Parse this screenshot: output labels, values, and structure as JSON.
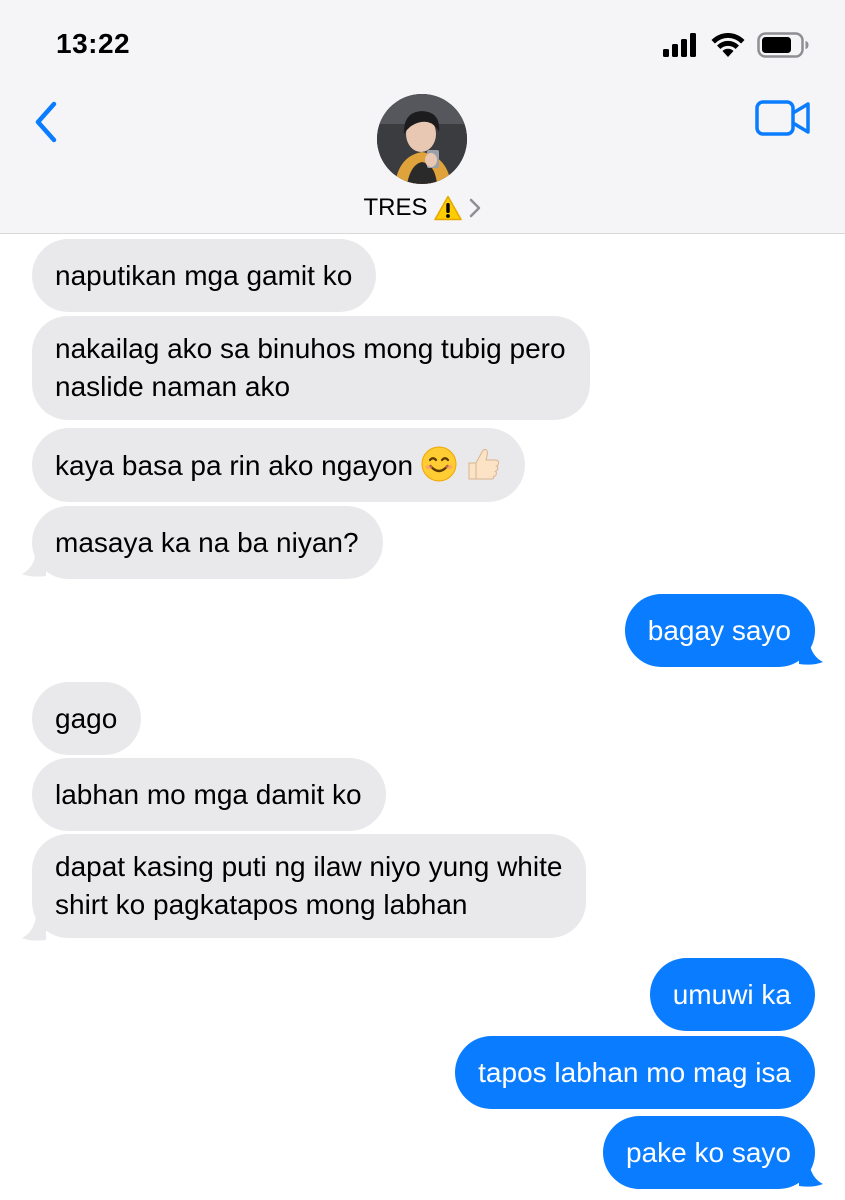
{
  "status_bar": {
    "time": "13:22"
  },
  "header": {
    "contact_name": "TRES",
    "back_icon": "chevron-left-icon",
    "video_icon": "video-camera-icon",
    "warning_icon": "warning-icon"
  },
  "colors": {
    "incoming": "#e9e9eb",
    "outgoing": "#0a7cff",
    "accent": "#0a7cff"
  },
  "messages": [
    {
      "from": "them",
      "text": "naputikan mga gamit ko"
    },
    {
      "from": "them",
      "line1": "nakailag ako sa binuhos mong tubig pero",
      "line2": "naslide naman ako"
    },
    {
      "from": "them",
      "text": "kaya basa pa rin ako ngayon",
      "emoji": [
        "smiling-face-icon",
        "thumbs-up-icon"
      ]
    },
    {
      "from": "them",
      "text": "masaya ka na ba niyan?"
    },
    {
      "from": "me",
      "text": "bagay sayo"
    },
    {
      "from": "them",
      "text": "gago"
    },
    {
      "from": "them",
      "text": "labhan mo mga damit ko"
    },
    {
      "from": "them",
      "line1": "dapat kasing puti ng ilaw niyo yung white",
      "line2": "shirt ko pagkatapos mong labhan"
    },
    {
      "from": "me",
      "text": "umuwi ka"
    },
    {
      "from": "me",
      "text": "tapos labhan mo mag isa"
    },
    {
      "from": "me",
      "text": "pake ko sayo"
    }
  ]
}
